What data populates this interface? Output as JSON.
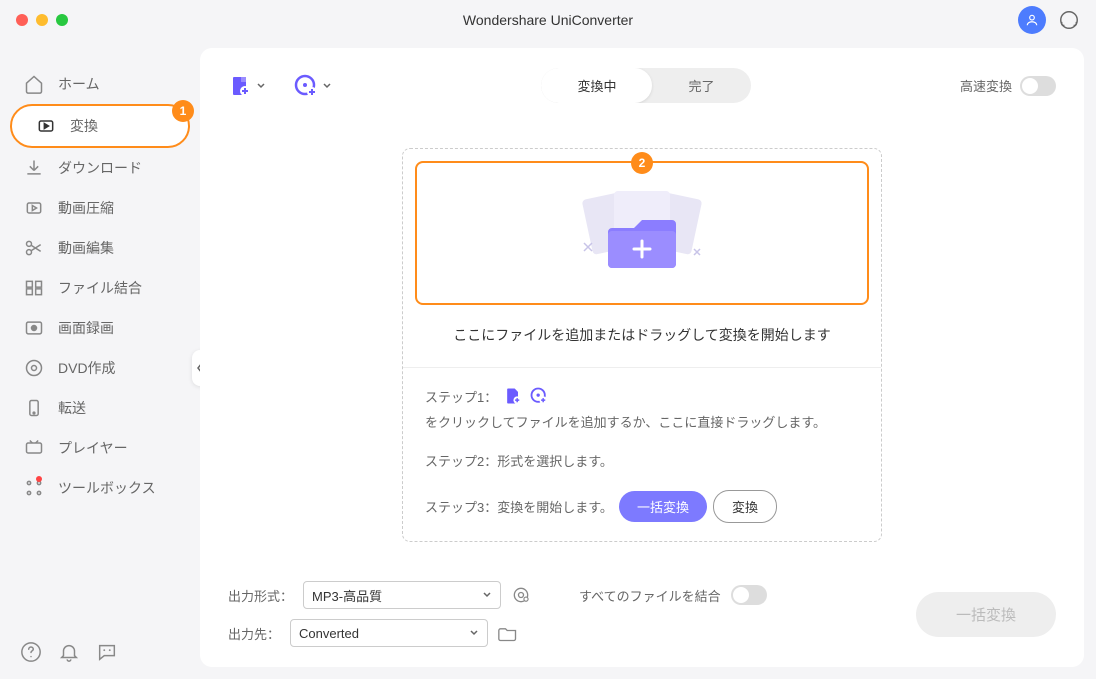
{
  "app": {
    "title": "Wondershare UniConverter"
  },
  "sidebar": {
    "items": [
      {
        "label": "ホーム"
      },
      {
        "label": "変換",
        "badge": "1"
      },
      {
        "label": "ダウンロード"
      },
      {
        "label": "動画圧縮"
      },
      {
        "label": "動画編集"
      },
      {
        "label": "ファイル結合"
      },
      {
        "label": "画面録画"
      },
      {
        "label": "DVD作成"
      },
      {
        "label": "転送"
      },
      {
        "label": "プレイヤー"
      },
      {
        "label": "ツールボックス"
      }
    ]
  },
  "segments": {
    "converting": "変換中",
    "done": "完了"
  },
  "fast_label": "高速変換",
  "drop": {
    "badge": "2",
    "text": "ここにファイルを追加またはドラッグして変換を開始します"
  },
  "steps": {
    "s1_prefix": "ステップ1：",
    "s1_suffix": "をクリックしてファイルを追加するか、ここに直接ドラッグします。",
    "s2": "ステップ2：形式を選択します。",
    "s3": "ステップ3：変換を開始します。",
    "batch_btn": "一括変換",
    "single_btn": "変換"
  },
  "footer": {
    "format_label": "出力形式：",
    "format_value": "MP3-高品質",
    "output_label": "出力先：",
    "output_value": "Converted",
    "merge_label": "すべてのファイルを結合",
    "batch": "一括変換"
  }
}
